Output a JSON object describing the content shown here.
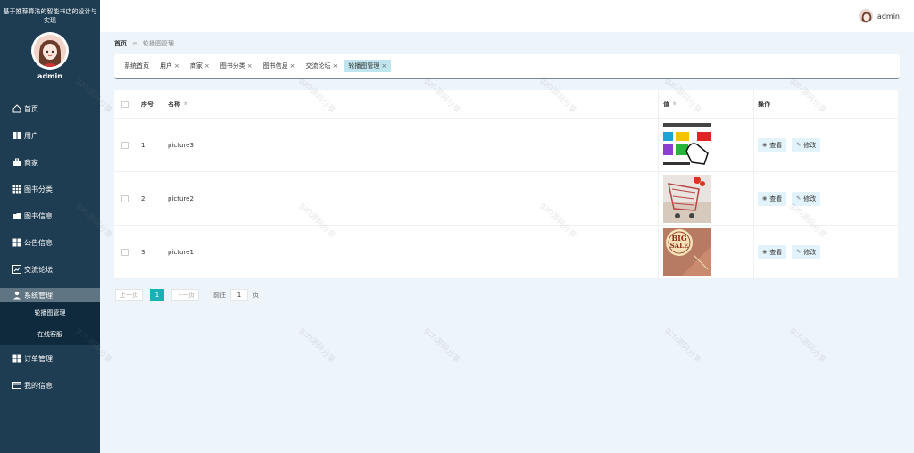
{
  "app": {
    "title": "基于推荐算法的智能书店的设计与实现",
    "user": "admin"
  },
  "sidebar": {
    "items": [
      {
        "label": "首页",
        "icon": "home-icon"
      },
      {
        "label": "用户",
        "icon": "book-icon"
      },
      {
        "label": "商家",
        "icon": "briefcase-icon"
      },
      {
        "label": "图书分类",
        "icon": "grid-icon"
      },
      {
        "label": "图书信息",
        "icon": "folder-icon"
      },
      {
        "label": "公告信息",
        "icon": "grid-icon"
      },
      {
        "label": "交流论坛",
        "icon": "chart-icon"
      },
      {
        "label": "系统管理",
        "icon": "user-icon"
      },
      {
        "label": "订单管理",
        "icon": "grid-icon"
      },
      {
        "label": "我的信息",
        "icon": "card-icon"
      }
    ],
    "submenu": [
      "轮播图管理",
      "在线客服"
    ]
  },
  "topbar": {
    "user": "admin"
  },
  "breadcrumb": {
    "home": "首页",
    "current": "轮播图管理"
  },
  "tags": [
    {
      "label": "系统首页",
      "closable": false
    },
    {
      "label": "用户",
      "closable": true
    },
    {
      "label": "商家",
      "closable": true
    },
    {
      "label": "图书分类",
      "closable": true
    },
    {
      "label": "图书信息",
      "closable": true
    },
    {
      "label": "交流论坛",
      "closable": true
    },
    {
      "label": "轮播图管理",
      "closable": true,
      "active": true
    }
  ],
  "table": {
    "headers": {
      "index": "序号",
      "name": "名称",
      "value": "值",
      "ops": "操作"
    },
    "rows": [
      {
        "index": "1",
        "name": "picture3"
      },
      {
        "index": "2",
        "name": "picture2"
      },
      {
        "index": "3",
        "name": "picture1"
      }
    ],
    "view_label": "查看",
    "edit_label": "修改"
  },
  "pagination": {
    "prev": "上一页",
    "page": "1",
    "next": "下一页",
    "goto": "前往",
    "goto_value": "1",
    "unit": "页"
  },
  "watermark": "gzh源码分享",
  "colors": {
    "sidebar": "#1f3d52",
    "accent": "#1ab1b6",
    "active_tag": "#bfe6ef"
  }
}
